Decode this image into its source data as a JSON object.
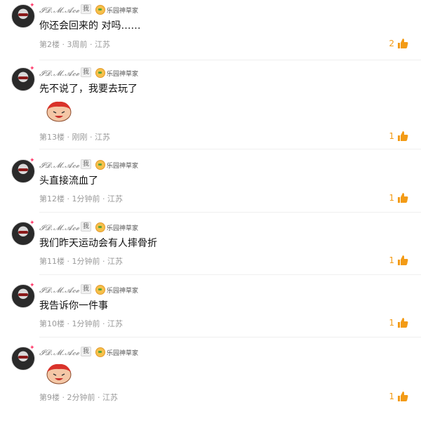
{
  "comments": [
    {
      "username": "𝓘𝓓.𝓜.𝓐𝓬𝓮日",
      "author_tag": "我",
      "group": "乐园神草家",
      "text": "你还会回来的 对吗……",
      "sticker": false,
      "meta": "第2楼 · 3周前 · 江苏",
      "likes": "2"
    },
    {
      "username": "𝓘𝓓.𝓜.𝓐𝓬𝓮日",
      "author_tag": "我",
      "group": "乐园神草家",
      "text": "先不说了，我要去玩了",
      "sticker": true,
      "meta": "第13楼 · 刚刚 · 江苏",
      "likes": "1"
    },
    {
      "username": "𝓘𝓓.𝓜.𝓐𝓬𝓮日",
      "author_tag": "我",
      "group": "乐园神草家",
      "text": "头直接流血了",
      "sticker": false,
      "meta": "第12楼 · 1分钟前 · 江苏",
      "likes": "1"
    },
    {
      "username": "𝓘𝓓.𝓜.𝓐𝓬𝓮日",
      "author_tag": "我",
      "group": "乐园神草家",
      "text": "我们昨天运动会有人摔骨折",
      "sticker": false,
      "meta": "第11楼 · 1分钟前 · 江苏",
      "likes": "1"
    },
    {
      "username": "𝓘𝓓.𝓜.𝓐𝓬𝓮日",
      "author_tag": "我",
      "group": "乐园神草家",
      "text": "我告诉你一件事",
      "sticker": false,
      "meta": "第10楼 · 1分钟前 · 江苏",
      "likes": "1"
    },
    {
      "username": "𝓘𝓓.𝓜.𝓐𝓬𝓮日",
      "author_tag": "我",
      "group": "乐园神草家",
      "text": "",
      "sticker": true,
      "meta": "第9楼 · 2分钟前 · 江苏",
      "likes": "1"
    }
  ],
  "colors": {
    "accent": "#f39b16",
    "meta": "#9a9a9a"
  },
  "icons": {
    "like": "thumbs-up-icon",
    "level": "leaf-badge-icon",
    "sticker": "laughing-face-sticker"
  }
}
